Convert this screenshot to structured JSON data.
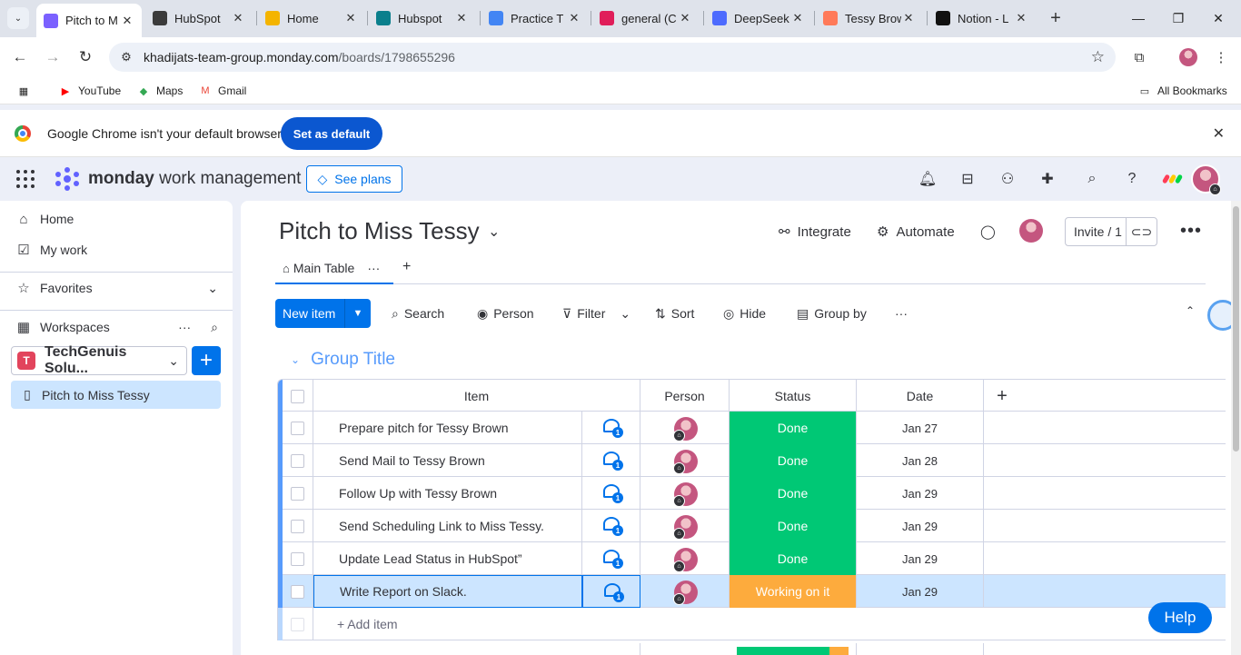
{
  "browser": {
    "tabs": [
      {
        "title": "Pitch to M",
        "icon": "monday-icon",
        "color": "#7b61ff",
        "active": true
      },
      {
        "title": "HubSpot",
        "icon": "openai-icon",
        "color": "#3b3b3b"
      },
      {
        "title": "Home",
        "icon": "home-icon",
        "color": "#f4b400"
      },
      {
        "title": "Hubspot",
        "icon": "person-card-icon",
        "color": "#0a7f8c"
      },
      {
        "title": "Practice T",
        "icon": "forms-icon",
        "color": "#4285f4"
      },
      {
        "title": "general (C",
        "icon": "slack-icon",
        "color": "#e01e5a"
      },
      {
        "title": "DeepSeek",
        "icon": "deepseek-icon",
        "color": "#4d6bfe"
      },
      {
        "title": "Tessy Brow",
        "icon": "hubspot-icon",
        "color": "#ff7a59"
      },
      {
        "title": "Notion - L",
        "icon": "notion-icon",
        "color": "#111111"
      }
    ],
    "url_host": "khadijats-team-group.monday.com",
    "url_path": "/boards/1798655296",
    "bookmarks": [
      {
        "label": "YouTube",
        "icon": "youtube-icon",
        "color": "#ff0000"
      },
      {
        "label": "Maps",
        "icon": "maps-icon",
        "color": "#34a853"
      },
      {
        "label": "Gmail",
        "icon": "gmail-icon",
        "color": "#ea4335"
      }
    ],
    "all_bookmarks": "All Bookmarks",
    "infobar": {
      "message": "Google Chrome isn't your default browser",
      "button": "Set as default"
    }
  },
  "app": {
    "brand_bold": "monday",
    "brand_light": " work management",
    "see_plans": "See plans"
  },
  "sidebar": {
    "home": "Home",
    "my_work": "My work",
    "favorites": "Favorites",
    "workspaces": "Workspaces",
    "workspace_initial": "T",
    "workspace_name": "TechGenuis Solu...",
    "board": "Pitch to Miss Tessy"
  },
  "board": {
    "title": "Pitch to Miss Tessy",
    "integrate": "Integrate",
    "automate": "Automate",
    "invite": "Invite / 1",
    "view_tab": "Main Table",
    "toolbar": {
      "new_item": "New item",
      "search": "Search",
      "person": "Person",
      "filter": "Filter",
      "sort": "Sort",
      "hide": "Hide",
      "group_by": "Group by"
    },
    "group_title": "Group Title",
    "columns": {
      "item": "Item",
      "person": "Person",
      "status": "Status",
      "date": "Date"
    },
    "rows": [
      {
        "item": "Prepare pitch for Tessy Brown",
        "updates": "1",
        "status": "Done",
        "status_color": "#00c875",
        "date": "Jan 27"
      },
      {
        "item": "Send Mail to Tessy Brown",
        "updates": "1",
        "status": "Done",
        "status_color": "#00c875",
        "date": "Jan 28"
      },
      {
        "item": "Follow Up with Tessy Brown",
        "updates": "1",
        "status": "Done",
        "status_color": "#00c875",
        "date": "Jan 29"
      },
      {
        "item": "Send Scheduling Link to Miss Tessy.",
        "updates": "1",
        "status": "Done",
        "status_color": "#00c875",
        "date": "Jan 29"
      },
      {
        "item": "Update Lead Status in HubSpot”",
        "updates": "1",
        "status": "Done",
        "status_color": "#00c875",
        "date": "Jan 29"
      },
      {
        "item": "Write Report on Slack.",
        "updates": "1",
        "status": "Working on it",
        "status_color": "#fdab3d",
        "date": "Jan 29"
      }
    ],
    "add_item": "+ Add item",
    "summary_fill": {
      "done": 0.83,
      "working": 0.17
    }
  },
  "help": "Help"
}
